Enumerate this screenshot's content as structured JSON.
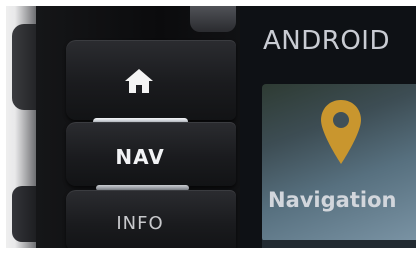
{
  "bezel": {
    "home_icon": "home-icon",
    "nav_label": "NAV",
    "info_label": "INFO"
  },
  "screen": {
    "title": "ANDROID",
    "tile": {
      "icon": "map-pin-icon",
      "label": "Navigation",
      "pin_color": "#c9962e"
    }
  }
}
